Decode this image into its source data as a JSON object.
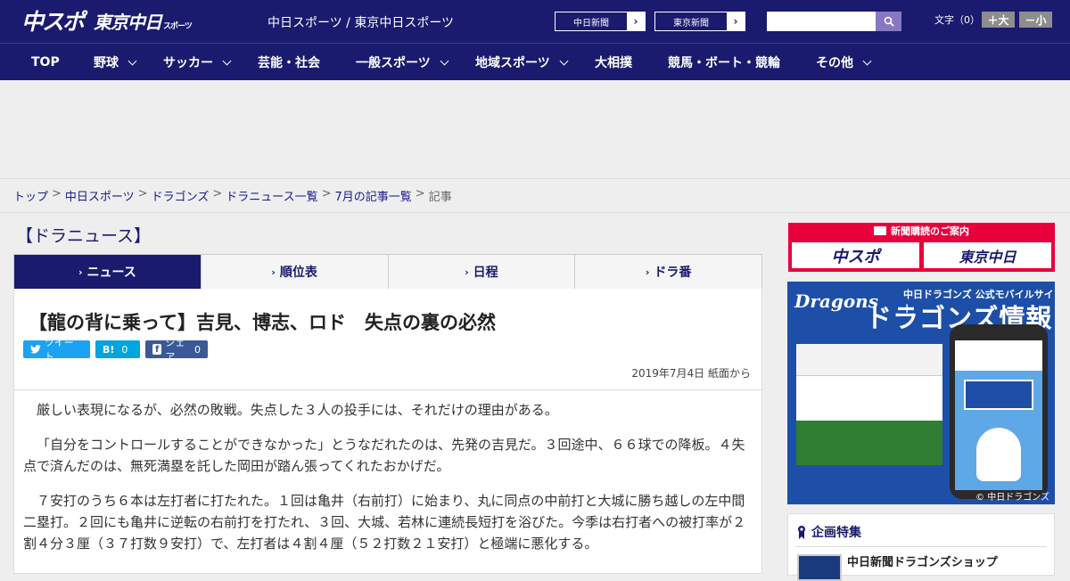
{
  "header": {
    "logo_main": "中スポ",
    "logo_sub": "東京中日",
    "logo_sub_small": "スポーツ",
    "site_title": "中日スポーツ / 東京中日スポーツ",
    "btn_chunichi": "中日新聞",
    "btn_tokyo": "東京新聞",
    "font_label": "文字（0）",
    "font_plus": "＋大",
    "font_minus": "－小"
  },
  "nav": {
    "items": [
      {
        "label": "TOP",
        "has_sub": false
      },
      {
        "label": "野球",
        "has_sub": true
      },
      {
        "label": "サッカー",
        "has_sub": true
      },
      {
        "label": "芸能・社会",
        "has_sub": false
      },
      {
        "label": "一般スポーツ",
        "has_sub": true
      },
      {
        "label": "地域スポーツ",
        "has_sub": true
      },
      {
        "label": "大相撲",
        "has_sub": false
      },
      {
        "label": "競馬・ボート・競輪",
        "has_sub": false
      },
      {
        "label": "その他",
        "has_sub": true
      }
    ]
  },
  "breadcrumb": {
    "items": [
      "トップ",
      "中日スポーツ",
      "ドラゴンズ",
      "ドラニュース一覧",
      "7月の記事一覧"
    ],
    "current": "記事",
    "sep": ">"
  },
  "section_title": "【ドラニュース】",
  "tabs": [
    {
      "label": "ニュース",
      "active": true
    },
    {
      "label": "順位表",
      "active": false
    },
    {
      "label": "日程",
      "active": false
    },
    {
      "label": "ドラ番",
      "active": false
    }
  ],
  "article": {
    "title": "【龍の背に乗って】吉見、博志、ロド　失点の裏の必然",
    "sns": {
      "tweet": "ツイート",
      "hatena": "B!",
      "hatena_count": "0",
      "facebook": "シェア",
      "facebook_count": "0"
    },
    "date": "2019年7月4日 紙面から",
    "paragraphs": [
      "厳しい表現になるが、必然の敗戦。失点した３人の投手には、それだけの理由がある。",
      "「自分をコントロールすることができなかった」とうなだれたのは、先発の吉見だ。３回途中、６６球での降板。４失点で済んだのは、無死満塁を託した岡田が踏ん張ってくれたおかげだ。",
      "７安打のうち６本は左打者に打たれた。１回は亀井（右前打）に始まり、丸に同点の中前打と大城に勝ち越しの左中間二塁打。２回にも亀井に逆転の右前打を打たれ、３回、大城、若林に連続長短打を浴びた。今季は右打者への被打率が２割４分３厘（３７打数９安打）で、左打者は４割４厘（５２打数２１安打）と極端に悪化する。"
    ]
  },
  "sidebar": {
    "subscribe_head": "新聞購読のご案内",
    "subscribe_box1": "中スポ",
    "subscribe_box2": "東京中日",
    "banner_logo": "Dragons",
    "banner_sub": "中日ドラゴンズ 公式モバイルサイト",
    "banner_main": "ドラゴンズ情報",
    "banner_foot": "© 中日ドラゴンズ",
    "feature_title": "企画特集",
    "feature_item": "中日新聞ドラゴンズショップ"
  },
  "colors": {
    "brand_navy": "#1a1a6e",
    "subscribe_red": "#e8003d",
    "twitter": "#1da1f2",
    "hatena": "#00a4de",
    "facebook": "#3b5998"
  }
}
